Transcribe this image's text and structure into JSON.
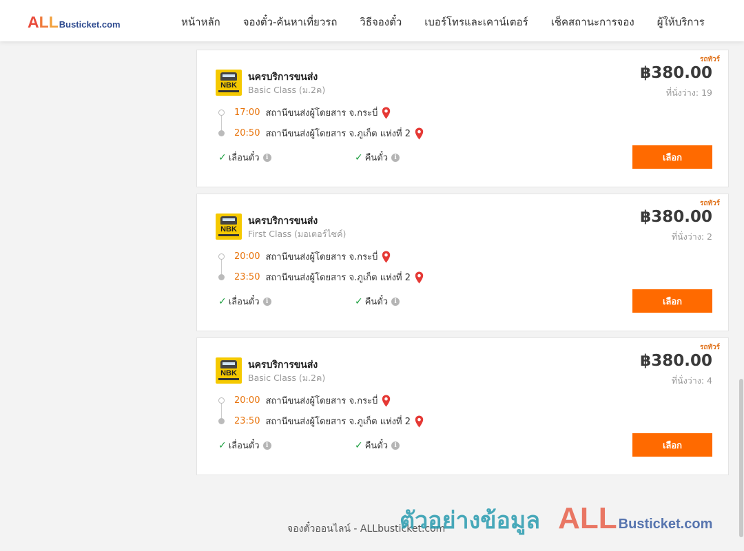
{
  "header": {
    "logo": {
      "all": "ALL",
      "rest": "Busticket.com"
    },
    "nav": [
      "หน้าหลัก",
      "จองตั๋ว-ค้นหาเที่ยวรถ",
      "วิธีจองตั๋ว",
      "เบอร์โทรและเคาน์เตอร์",
      "เช็คสถานะการจอง",
      "ผู้ให้บริการ"
    ]
  },
  "colors": {
    "accent": "#ff6a00",
    "time": "#e8740c",
    "check": "#1b9e3e",
    "pin": "#e53935"
  },
  "trips": [
    {
      "badge": "รถทัวร์",
      "operator": "นครบริการขนส่ง",
      "operator_logo": "NBK",
      "bus_class": "Basic Class (ม.2ค)",
      "price": "฿380.00",
      "seats": "ที่นั่งว่าง: 19",
      "departure": {
        "time": "17:00",
        "place": "สถานีขนส่งผู้โดยสาร จ.กระบี่"
      },
      "arrival": {
        "time": "20:50",
        "place": "สถานีขนส่งผู้โดยสาร จ.ภูเก็ต แห่งที่ 2"
      },
      "feature1": "เลื่อนตั๋ว",
      "feature2": "คืนตั๋ว",
      "button": "เลือก"
    },
    {
      "badge": "รถทัวร์",
      "operator": "นครบริการขนส่ง",
      "operator_logo": "NBK",
      "bus_class": "First Class (มอเตอร์ไซค์)",
      "price": "฿380.00",
      "seats": "ที่นั่งว่าง: 2",
      "departure": {
        "time": "20:00",
        "place": "สถานีขนส่งผู้โดยสาร จ.กระบี่"
      },
      "arrival": {
        "time": "23:50",
        "place": "สถานีขนส่งผู้โดยสาร จ.ภูเก็ต แห่งที่ 2"
      },
      "feature1": "เลื่อนตั๋ว",
      "feature2": "คืนตั๋ว",
      "button": "เลือก"
    },
    {
      "badge": "รถทัวร์",
      "operator": "นครบริการขนส่ง",
      "operator_logo": "NBK",
      "bus_class": "Basic Class (ม.2ค)",
      "price": "฿380.00",
      "seats": "ที่นั่งว่าง: 4",
      "departure": {
        "time": "20:00",
        "place": "สถานีขนส่งผู้โดยสาร จ.กระบี่"
      },
      "arrival": {
        "time": "23:50",
        "place": "สถานีขนส่งผู้โดยสาร จ.ภูเก็ต แห่งที่ 2"
      },
      "feature1": "เลื่อนตั๋ว",
      "feature2": "คืนตั๋ว",
      "button": "เลือก"
    }
  ],
  "footer": {
    "text": "จองตั๋วออนไลน์ - ALLbusticket.com"
  },
  "watermark": {
    "text": "ตัวอย่างข้อมูล",
    "all": "ALL",
    "rest": "Busticket.com"
  }
}
